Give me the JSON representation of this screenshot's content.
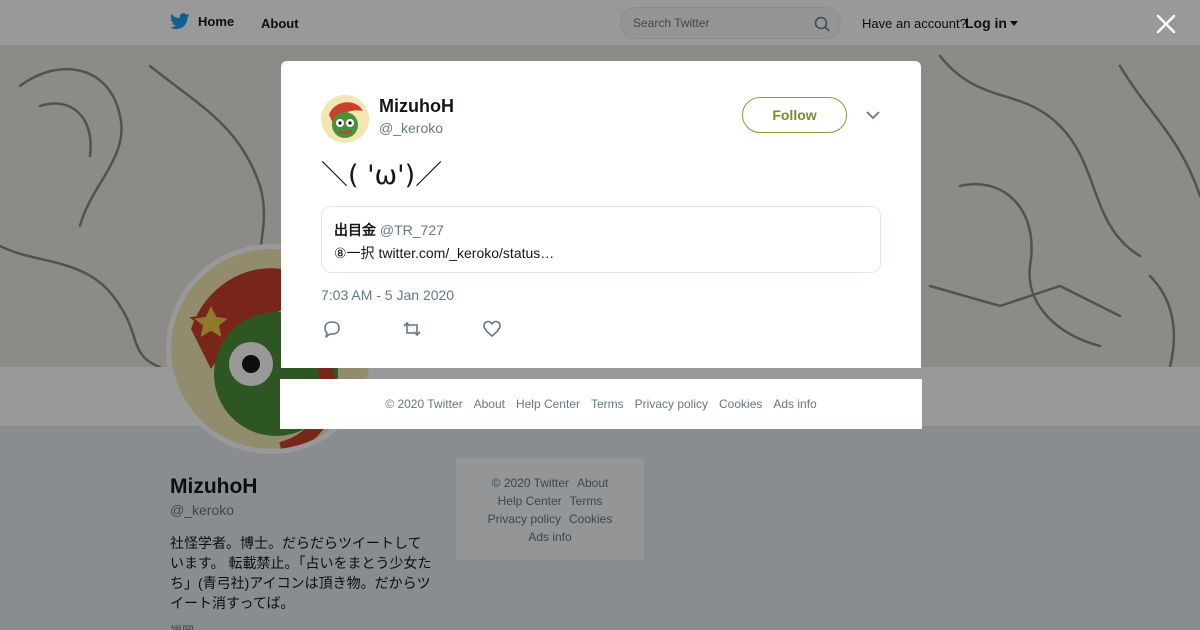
{
  "topbar": {
    "home_label": "Home",
    "about_label": "About",
    "search_placeholder": "Search Twitter",
    "have_account": "Have an account?",
    "login_label": "Log in"
  },
  "profile": {
    "name": "MizuhoH",
    "handle": "@_keroko",
    "bio": "社怪学者。博士。だらだらツイートしています。 転載禁止。「占いをまとう少女たち」(青弓社)アイコンは頂き物。だからツイート消すってば。",
    "location": "福岡"
  },
  "sidebar_footer": {
    "items": [
      "© 2020 Twitter",
      "About",
      "Help Center",
      "Terms",
      "Privacy policy",
      "Cookies",
      "Ads info"
    ]
  },
  "tweet": {
    "name": "MizuhoH",
    "handle": "@_keroko",
    "follow_label": "Follow",
    "text": "＼( 'ω')／",
    "quote": {
      "name": "出目金",
      "handle": "@TR_727",
      "text": "⑧一択 twitter.com/_keroko/status…"
    },
    "time": "7:03 AM - 5 Jan 2020"
  },
  "modal_footer": {
    "items": [
      "© 2020 Twitter",
      "About",
      "Help Center",
      "Terms",
      "Privacy policy",
      "Cookies",
      "Ads info"
    ]
  },
  "colors": {
    "twitter_blue": "#1da1f2",
    "follow_accent": "#7a8a2e",
    "overlay": "rgba(0,0,0,0.4)"
  },
  "icons": [
    "twitter-bird-icon",
    "search-icon",
    "caret-down-icon",
    "close-icon",
    "chevron-down-icon",
    "reply-icon",
    "retweet-icon",
    "like-icon"
  ]
}
